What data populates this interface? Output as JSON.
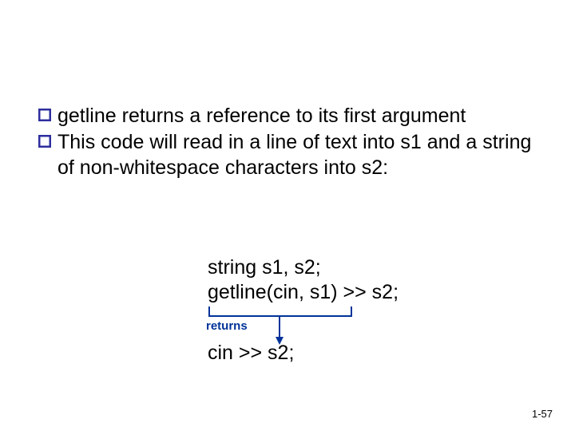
{
  "bullets": [
    {
      "text": "getline returns a reference to its first argument"
    },
    {
      "text": "This code will read in a line of text into s1 and a string of non-whitespace characters into s2:"
    }
  ],
  "code": {
    "line1": "string s1, s2;",
    "line2": "getline(cin, s1) >> s2;"
  },
  "annotation": {
    "label": "returns",
    "result": "cin >> s2;"
  },
  "page_number": "1-57",
  "colors": {
    "marker": "#2e2e9e",
    "arrow": "#003399",
    "label": "#003399"
  }
}
